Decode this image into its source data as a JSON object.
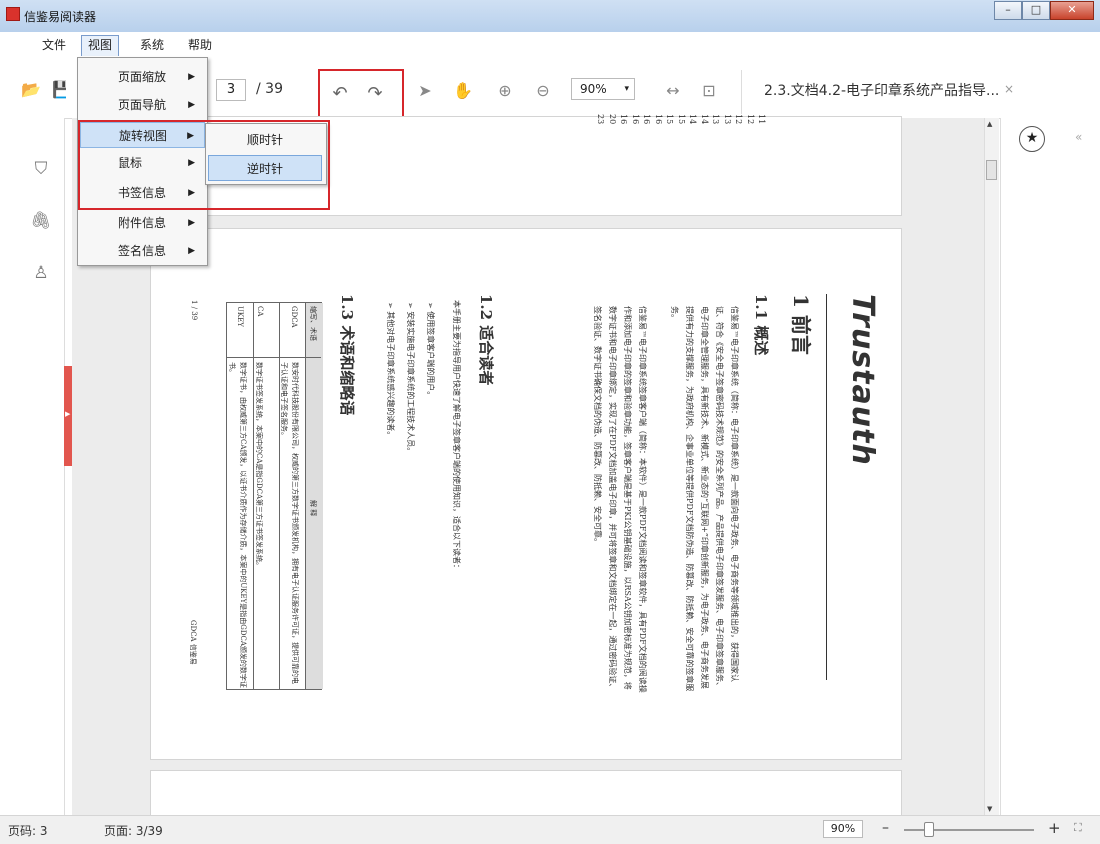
{
  "window": {
    "title": "信鉴易阅读器",
    "minimize": "–",
    "maximize": "□",
    "close": "✕"
  },
  "menubar": [
    "文件",
    "视图",
    "系统",
    "帮助"
  ],
  "toolbar": {
    "page_current": "3",
    "page_total": "/ 39",
    "zoom": "90%",
    "zoom_caret": "▾",
    "rotate_ccw": "↶",
    "rotate_cw": "↷"
  },
  "tab": {
    "title": "2.3.文档4.2-电子印章系统产品指导...",
    "close": "×"
  },
  "view_menu": {
    "items": [
      {
        "label": "页面缩放",
        "arrow": "▶"
      },
      {
        "label": "页面导航",
        "arrow": "▶"
      },
      {
        "label": "旋转视图",
        "arrow": "▶"
      },
      {
        "label": "鼠标",
        "arrow": "▶"
      },
      {
        "label": "书签信息",
        "arrow": "▶"
      },
      {
        "label": "附件信息",
        "arrow": "▶"
      },
      {
        "label": "签名信息",
        "arrow": "▶"
      }
    ],
    "highlighted_index": 2
  },
  "rotate_submenu": {
    "items": [
      "顺时针",
      "逆时针"
    ],
    "highlighted_index": 1
  },
  "document": {
    "toc_numbers": [
      "11",
      "12",
      "12",
      "13",
      "13",
      "14",
      "14",
      "15",
      "15",
      "16",
      "16",
      "16",
      "16",
      "20",
      "23"
    ],
    "brand": "Trustauth",
    "chapter_heading": "1 前言",
    "section_1_1": "1.1 概述",
    "para_1": "信鉴易™电子印章系统（简称：电子印章系统）是一款面向电子政务、电子商务等领域推出的，获得国家认证、符合《安全电子签章密码技术规范》的安全系列产品。产品提供电子印章签发服务、电子印章签章服务、电子印章全管理服务，具有新技术、新模式、新业态的“互联网+”印章创新服务，为电子政务、电子商务发展提供有力的支撑服务，为政府机构、企事业单位等提供PDF文档防伪造、防篡改、防抵赖、安全可靠的签章服务。",
    "para_2": "信鉴易™电子印章系统签章客户端（简称：本软件）是一款PDF文档阅读和签章软件，具有PDF文档的阅读操作和添加电子印章的签章和验章功能，签章客户端是基于PKI公钥基础设施，以RSA公钥加密标准为规范，将数字证书和电子印章绑定，实现了在PDF文档加盖电子印章，并可将签章和文档绑定在一起，通过密码验证、签名验证、数字证书确保文档的伪造、防篡改、防抵赖、安全可靠。",
    "section_1_2": "1.2 适合读者",
    "para_3": "本手册主要为指导用户快速了解电子签章客户端的使用知识，适合以下读者：",
    "bullets": [
      "使用签章客户端的用户。",
      "安装实施电子印章系统的工程技术人员。",
      "其他对电子印章系统感兴趣的读者。"
    ],
    "section_1_3": "1.3 术语和缩略语",
    "table_header": [
      "缩写、术语",
      "解 释"
    ],
    "table_rows": [
      [
        "GDCA",
        "数安时代科技股份有限公司，权威的第三方数字证书颁发机构，拥有电子认证服务许可证，提供可靠的电子认证和电子签名服务。"
      ],
      [
        "CA",
        "数字证书签发系统，本案中的CA是指GDCA第三方证书签发系统。"
      ],
      [
        "UKEY",
        "数字证书，由权威第三方CA颁发，以证书介质作为存储介质，本案中的UKEY是指由GDCA颁发的数字证书。"
      ]
    ],
    "footer_left": "1 / 39",
    "footer_right": "GDCA 信鉴易"
  },
  "statusbar": {
    "page_index": "页码: 3",
    "page_info": "页面: 3/39",
    "zoom": "90%",
    "zoom_minus": "–",
    "zoom_plus": "+",
    "fit": "⛶"
  },
  "right_panel": {
    "star": "★",
    "collapse": "«"
  },
  "left_sidebar": {
    "bookmark": "⛉",
    "attachment": "🖇",
    "signature": "♙"
  },
  "icons": {
    "open": "📂",
    "save": "💾",
    "select": "➤",
    "hand": "✋",
    "zoom_in": "⊕",
    "zoom_out": "⊖",
    "fit_width": "↔",
    "fit_page": "⊡"
  },
  "colors": {
    "highlight_box": "#d6262b",
    "menu_highlight": "#cfe2f7",
    "sidebar_strip": "#e2564e"
  }
}
